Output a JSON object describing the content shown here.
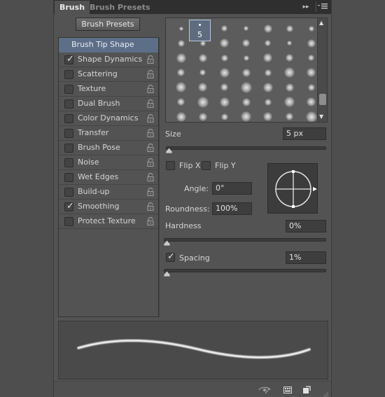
{
  "tabs": [
    {
      "label": "Brush",
      "active": true
    },
    {
      "label": "Brush Presets",
      "active": false
    }
  ],
  "panel_controls": {
    "collapse_icon": "double-chevron-right-icon",
    "menu_icon": "panel-menu-icon"
  },
  "brush_presets_button": "Brush Presets",
  "left_list": {
    "header": "Brush Tip Shape",
    "items": [
      {
        "label": "Shape Dynamics",
        "checked": true
      },
      {
        "label": "Scattering",
        "checked": false
      },
      {
        "label": "Texture",
        "checked": false
      },
      {
        "label": "Dual Brush",
        "checked": false
      },
      {
        "label": "Color Dynamics",
        "checked": false
      },
      {
        "label": "Transfer",
        "checked": false
      },
      {
        "label": "Brush Pose",
        "checked": false
      },
      {
        "label": "Noise",
        "checked": false
      },
      {
        "label": "Wet Edges",
        "checked": false
      },
      {
        "label": "Build-up",
        "checked": false
      },
      {
        "label": "Smoothing",
        "checked": true
      },
      {
        "label": "Protect Texture",
        "checked": false
      }
    ]
  },
  "brush_tips": {
    "selected_size": "5"
  },
  "size": {
    "label": "Size",
    "value": "5 px",
    "slider_fraction": 0.01
  },
  "flip_x": {
    "label": "Flip X",
    "checked": false
  },
  "flip_y": {
    "label": "Flip Y",
    "checked": false
  },
  "angle": {
    "label": "Angle:",
    "value": "0°"
  },
  "roundness": {
    "label": "Roundness:",
    "value": "100%"
  },
  "hardness": {
    "label": "Hardness",
    "value": "0%",
    "slider_fraction": 0.0
  },
  "spacing": {
    "label": "Spacing",
    "checked": true,
    "value": "1%",
    "slider_fraction": 0.01
  },
  "footer_icons": [
    "toggle-visibility-icon",
    "create-preset-icon",
    "new-brush-icon"
  ],
  "colors": {
    "panel": "#535353",
    "tabbar": "#2f2f2f",
    "selected_row": "#5d6e88",
    "field": "#3e3e3e"
  }
}
